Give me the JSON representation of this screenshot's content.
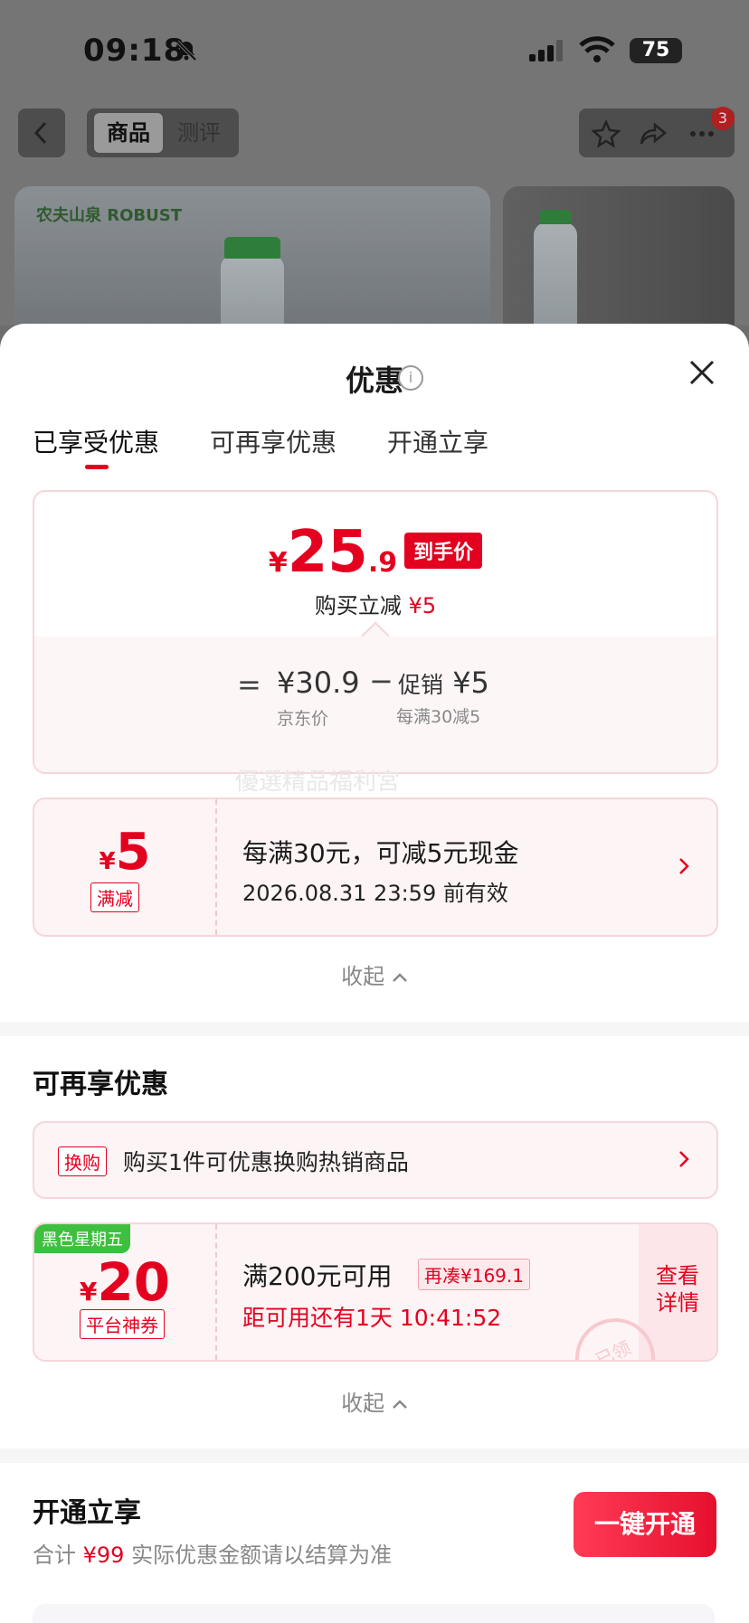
{
  "status_bar": {
    "time": "09:18",
    "battery": "75"
  },
  "nav": {
    "tab_product": "商品",
    "tab_review": "测评",
    "notification_count": "3"
  },
  "product_bg": {
    "brand_logo": "农夫山泉 ROBUST"
  },
  "sheet": {
    "title": "优惠",
    "tabs": [
      {
        "label": "已享受优惠"
      },
      {
        "label": "可再享优惠"
      },
      {
        "label": "开通立享"
      }
    ],
    "summary": {
      "currency": "¥",
      "price_int": "25",
      "price_dec": ".9",
      "price_tag": "到手价",
      "subtitle_prefix": "购买立减",
      "subtitle_amount": "¥5",
      "equals": "=",
      "jd_price": "¥30.9",
      "jd_label": "京东价",
      "minus": "−",
      "promo_label": "促销",
      "promo_amount": "¥5",
      "promo_rule": "每满30减5"
    },
    "watermark": "優選精品福利宮",
    "coupon": {
      "currency": "¥",
      "amount": "5",
      "type": "满减",
      "title": "每满30元，可减5元现金",
      "validity": "2026.08.31 23:59 前有效"
    },
    "collapse_label": "收起",
    "more": {
      "title": "可再享优惠",
      "exchange_tag": "换购",
      "exchange_text": "购买1件可优惠换购热销商品",
      "coupon": {
        "badge": "黑色星期五",
        "currency": "¥",
        "amount": "20",
        "type": "平台神券",
        "title": "满200元可用",
        "need": "再凑¥169.1",
        "countdown": "距可用还有1天 10:41:52",
        "detail": "查看详情",
        "stamp": "已领"
      },
      "collapse_label": "收起"
    },
    "open": {
      "title": "开通立享",
      "sub_prefix": "合计",
      "sub_amount": "¥99",
      "sub_suffix": "实际优惠金额请以结算为准",
      "button": "一键开通"
    }
  },
  "colors": {
    "accent": "#e4001f",
    "pink_bg": "#fdf4f5",
    "pink_border": "#f6d6d9",
    "green_badge": "#3fbf3f"
  }
}
